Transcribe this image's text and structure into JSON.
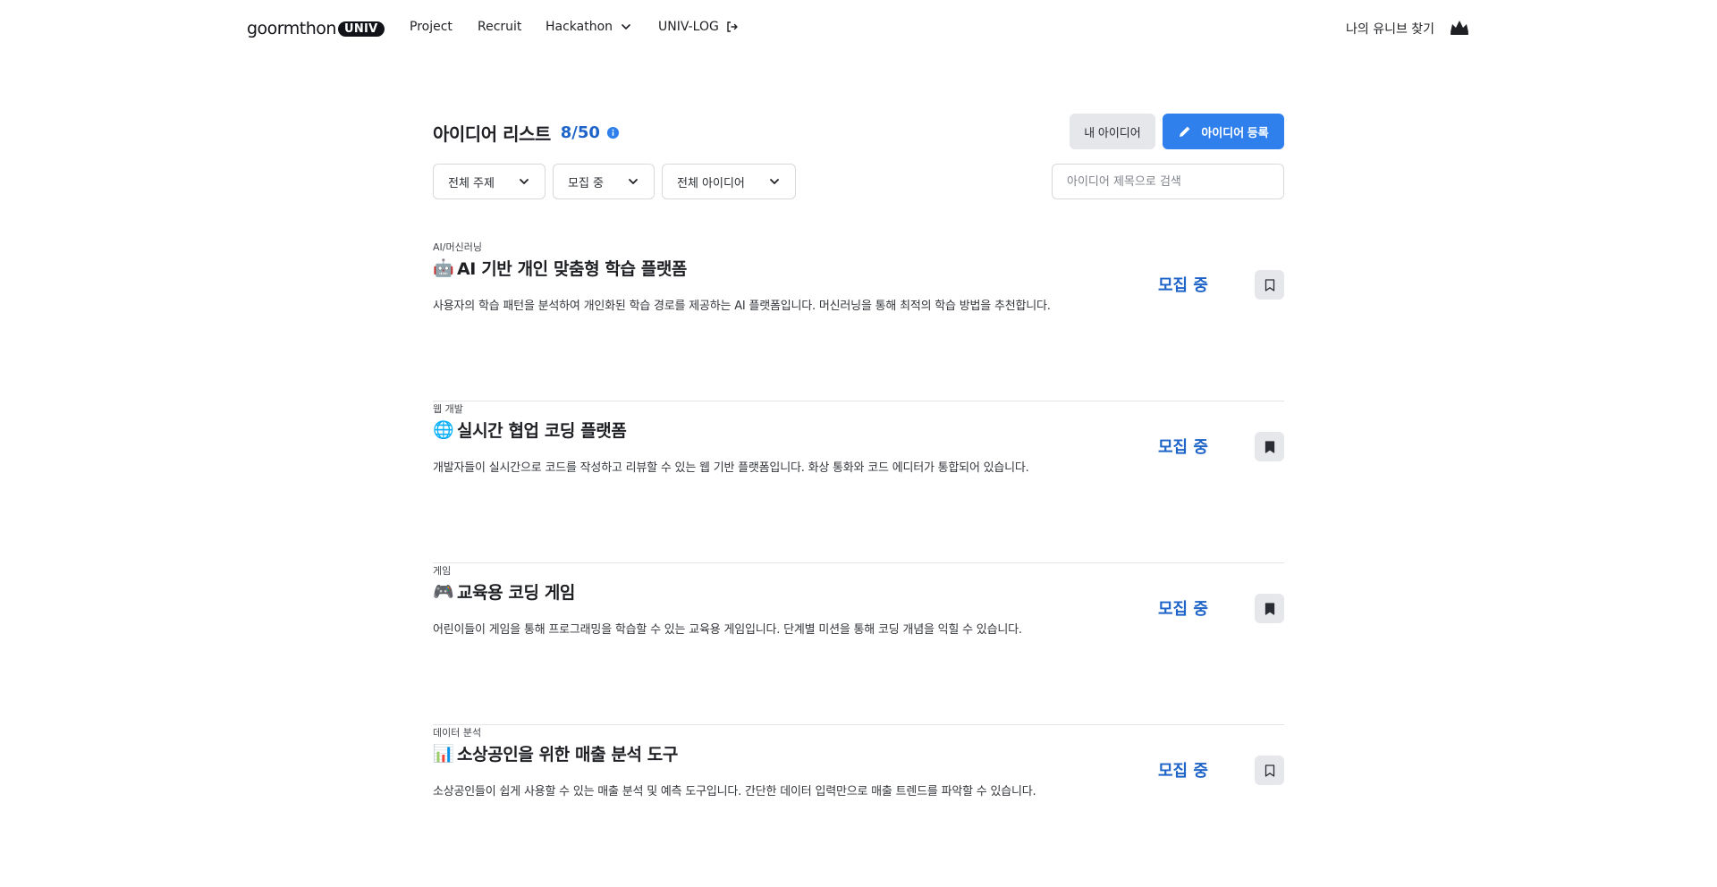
{
  "nav": {
    "logo_text": "goormthon",
    "logo_badge": "UNIV",
    "project": "Project",
    "recruit": "Recruit",
    "hackathon": "Hackathon",
    "univlog": "UNIV-LOG",
    "find_univ": "나의 유니브 찾기"
  },
  "header": {
    "title": "아이디어 리스트",
    "count": "8/50",
    "my_ideas": "내 아이디어",
    "register": "아이디어 등록"
  },
  "filters": {
    "topic": "전체 주제",
    "status": "모집 중",
    "ideas": "전체 아이디어",
    "search_placeholder": "아이디어 제목으로 검색"
  },
  "ideas": [
    {
      "category": "AI/머신러닝",
      "emoji": "🤖",
      "title": "AI 기반 개인 맞춤형 학습 플랫폼",
      "description": "사용자의 학습 패턴을 분석하여 개인화된 학습 경로를 제공하는 AI 플랫폼입니다. 머신러닝을 통해 최적의 학습 방법을 추천합니다.",
      "status": "모집 중",
      "bookmark_icon": "bookmark-outline-icon"
    },
    {
      "category": "웹 개발",
      "emoji": "🌐",
      "title": "실시간 협업 코딩 플랫폼",
      "description": "개발자들이 실시간으로 코드를 작성하고 리뷰할 수 있는 웹 기반 플랫폼입니다. 화상 통화와 코드 에디터가 통합되어 있습니다.",
      "status": "모집 중",
      "bookmark_icon": "bookmark-filled-icon"
    },
    {
      "category": "게임",
      "emoji": "🎮",
      "title": "교육용 코딩 게임",
      "description": "어린이들이 게임을 통해 프로그래밍을 학습할 수 있는 교육용 게임입니다. 단계별 미션을 통해 코딩 개념을 익힐 수 있습니다.",
      "status": "모집 중",
      "bookmark_icon": "bookmark-filled-icon"
    },
    {
      "category": "데이터 분석",
      "emoji": "📊",
      "title": "소상공인을 위한 매출 분석 도구",
      "description": "소상공인들이 쉽게 사용할 수 있는 매출 분석 및 예측 도구입니다. 간단한 데이터 입력만으로 매출 트렌드를 파악할 수 있습니다.",
      "status": "모집 중",
      "bookmark_icon": "bookmark-outline-icon"
    }
  ],
  "colors": {
    "accent": "#2f80ed",
    "status": "#1e64c8",
    "button_gray": "#e6e7eb"
  }
}
